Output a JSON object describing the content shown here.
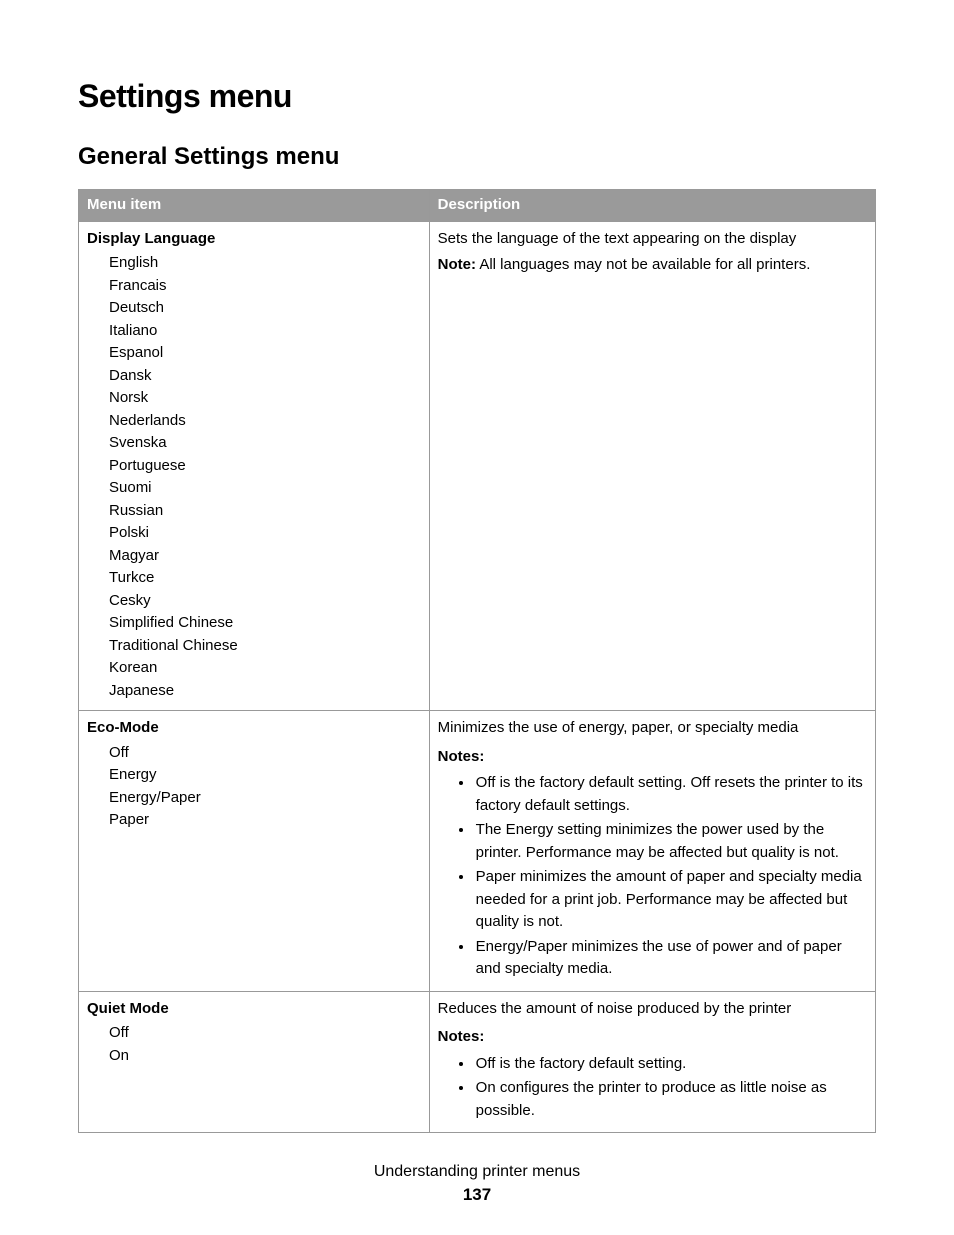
{
  "page_title": "Settings menu",
  "section_title": "General Settings menu",
  "table": {
    "headers": {
      "item": "Menu item",
      "desc": "Description"
    },
    "rows": [
      {
        "name": "Display Language",
        "options": [
          "English",
          "Francais",
          "Deutsch",
          "Italiano",
          "Espanol",
          "Dansk",
          "Norsk",
          "Nederlands",
          "Svenska",
          "Portuguese",
          "Suomi",
          "Russian",
          "Polski",
          "Magyar",
          "Turkce",
          "Cesky",
          "Simplified Chinese",
          "Traditional Chinese",
          "Korean",
          "Japanese"
        ],
        "desc": "Sets the language of the text appearing on the display",
        "note_label": "Note:",
        "note_text": " All languages may not be available for all printers."
      },
      {
        "name": "Eco-Mode",
        "options": [
          "Off",
          "Energy",
          "Energy/Paper",
          "Paper"
        ],
        "desc": "Minimizes the use of energy, paper, or specialty media",
        "notes_heading": "Notes:",
        "notes": [
          "Off is the factory default setting. Off resets the printer to its factory default settings.",
          "The Energy setting minimizes the power used by the printer. Performance may be affected but quality is not.",
          "Paper minimizes the amount of paper and specialty media needed for a print job. Performance may be affected but quality is not.",
          "Energy/Paper minimizes the use of power and of paper and specialty media."
        ]
      },
      {
        "name": "Quiet Mode",
        "options": [
          "Off",
          "On"
        ],
        "desc": "Reduces the amount of noise produced by the printer",
        "notes_heading": "Notes:",
        "notes": [
          "Off is the factory default setting.",
          "On configures the printer to produce as little noise as possible."
        ]
      }
    ]
  },
  "footer": {
    "section": "Understanding printer menus",
    "page_number": "137"
  }
}
